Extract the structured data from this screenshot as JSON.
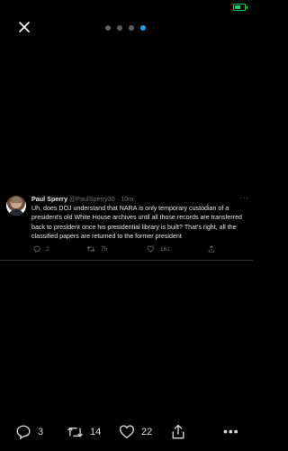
{
  "colors": {
    "background": "#000000",
    "accent": "#1d9bf0",
    "battery": "#1fd15a",
    "muted": "#71767b"
  },
  "status_bar": {
    "battery_icon": "battery-icon"
  },
  "top_bar": {
    "close_icon": "close-icon",
    "pager": {
      "count": 4,
      "active_index": 3
    }
  },
  "tweet": {
    "author_name": "Paul Sperry",
    "handle": "@PaulSperry30",
    "separator": "·",
    "time": "10m",
    "more": "···",
    "text": "Uh, does DOJ understand that NARA is only temporary custodian of a president's old White House archives until all those records are transferred back to president once his presidential library is built? That's right, all the classified papers are returned to the former president",
    "actions": {
      "replies": "2",
      "retweets": "75",
      "likes": "161"
    }
  },
  "bottom_bar": {
    "replies": "3",
    "retweets": "14",
    "likes": "22",
    "more": "•••"
  }
}
